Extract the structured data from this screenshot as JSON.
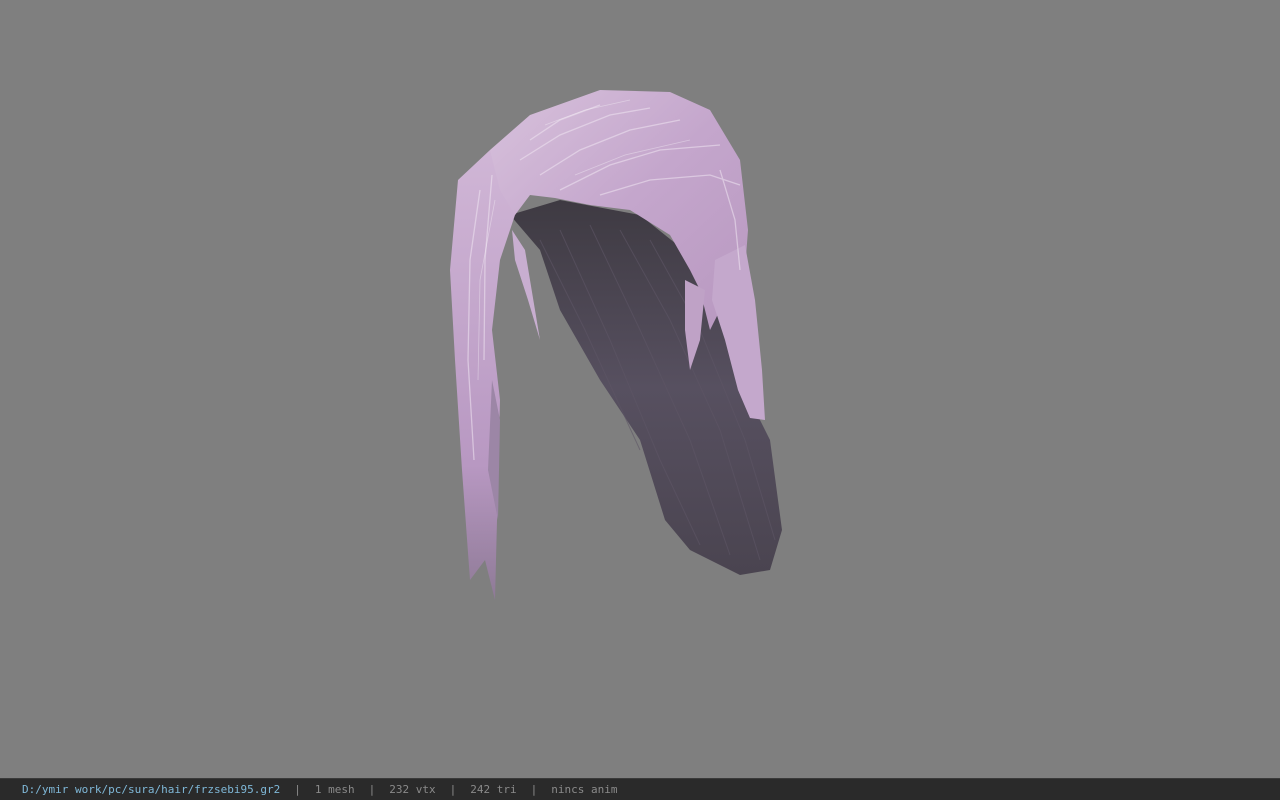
{
  "viewer": {
    "background_color": "#7f7f7f",
    "model_icon": "hair-mesh-icon",
    "hair_colors": {
      "light": "#c9aad0",
      "highlight": "#ece0ee",
      "dark": "#4a4450",
      "shadow": "#5a4f5e"
    }
  },
  "status": {
    "file_path": "D:/ymir work/pc/sura/hair/frzsebi95.gr2",
    "separator": "|",
    "mesh_count": "1 mesh",
    "vertex_count": "232 vtx",
    "triangle_count": "242 tri",
    "anim_status": "nincs anim"
  }
}
